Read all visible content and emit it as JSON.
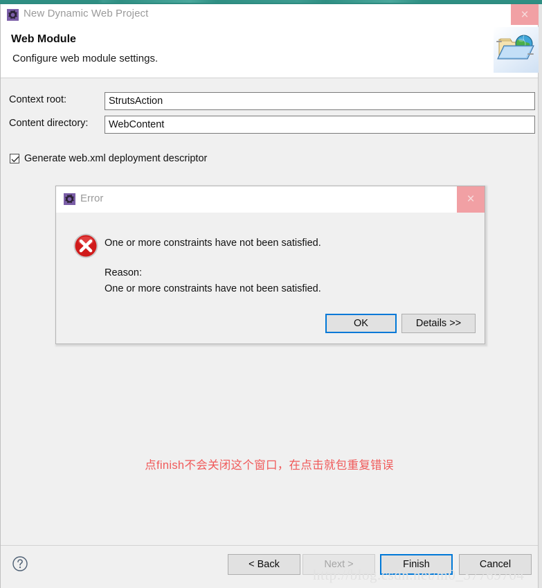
{
  "window": {
    "title": "New Dynamic Web Project",
    "title_icon": "gear-icon",
    "close_label": "×",
    "header_title": "Web Module",
    "header_subtitle": "Configure web module settings.",
    "header_icon": "folder-globe-icon"
  },
  "form": {
    "fields": [
      {
        "label": "Context root:",
        "value": "StrutsAction",
        "placeholder": ""
      },
      {
        "label": "Content directory:",
        "value": "WebContent",
        "placeholder": ""
      }
    ],
    "checkbox": {
      "label": "Generate web.xml deployment descriptor",
      "checked": true,
      "check_mark": "✓"
    }
  },
  "annotation": {
    "text": "点finish不会关闭这个窗口，在点击就包重复错误",
    "color": "#f05a5a"
  },
  "footer": {
    "help_icon": "question-mark-icon",
    "buttons": [
      {
        "label": "< Back",
        "state": "enabled"
      },
      {
        "label": "Next >",
        "state": "disabled"
      },
      {
        "label": "Finish",
        "state": "focused"
      },
      {
        "label": "Cancel",
        "state": "enabled"
      }
    ]
  },
  "watermark": {
    "text": "http://blog.csdn.net/m0_37769704"
  },
  "error_dialog": {
    "title": "Error",
    "title_icon": "gear-icon",
    "close_label": "×",
    "status_icon": "error-circle-x-icon",
    "message": "One or more constraints have not been satisfied.",
    "reason_label": "Reason:",
    "reason_text": "One or more constraints have not been satisfied.",
    "buttons": [
      {
        "label": "OK",
        "state": "focused"
      },
      {
        "label": "Details >>",
        "state": "enabled"
      }
    ]
  },
  "colors": {
    "accent_focus": "#0078d7",
    "close_hover": "#f1a0a4",
    "dialog_bg": "#f0f0f0",
    "titlebar_bg": "#ffffff",
    "error_red": "#d01b1b",
    "annotation_red": "#f05a5a",
    "top_strip": "#2f8f83"
  }
}
